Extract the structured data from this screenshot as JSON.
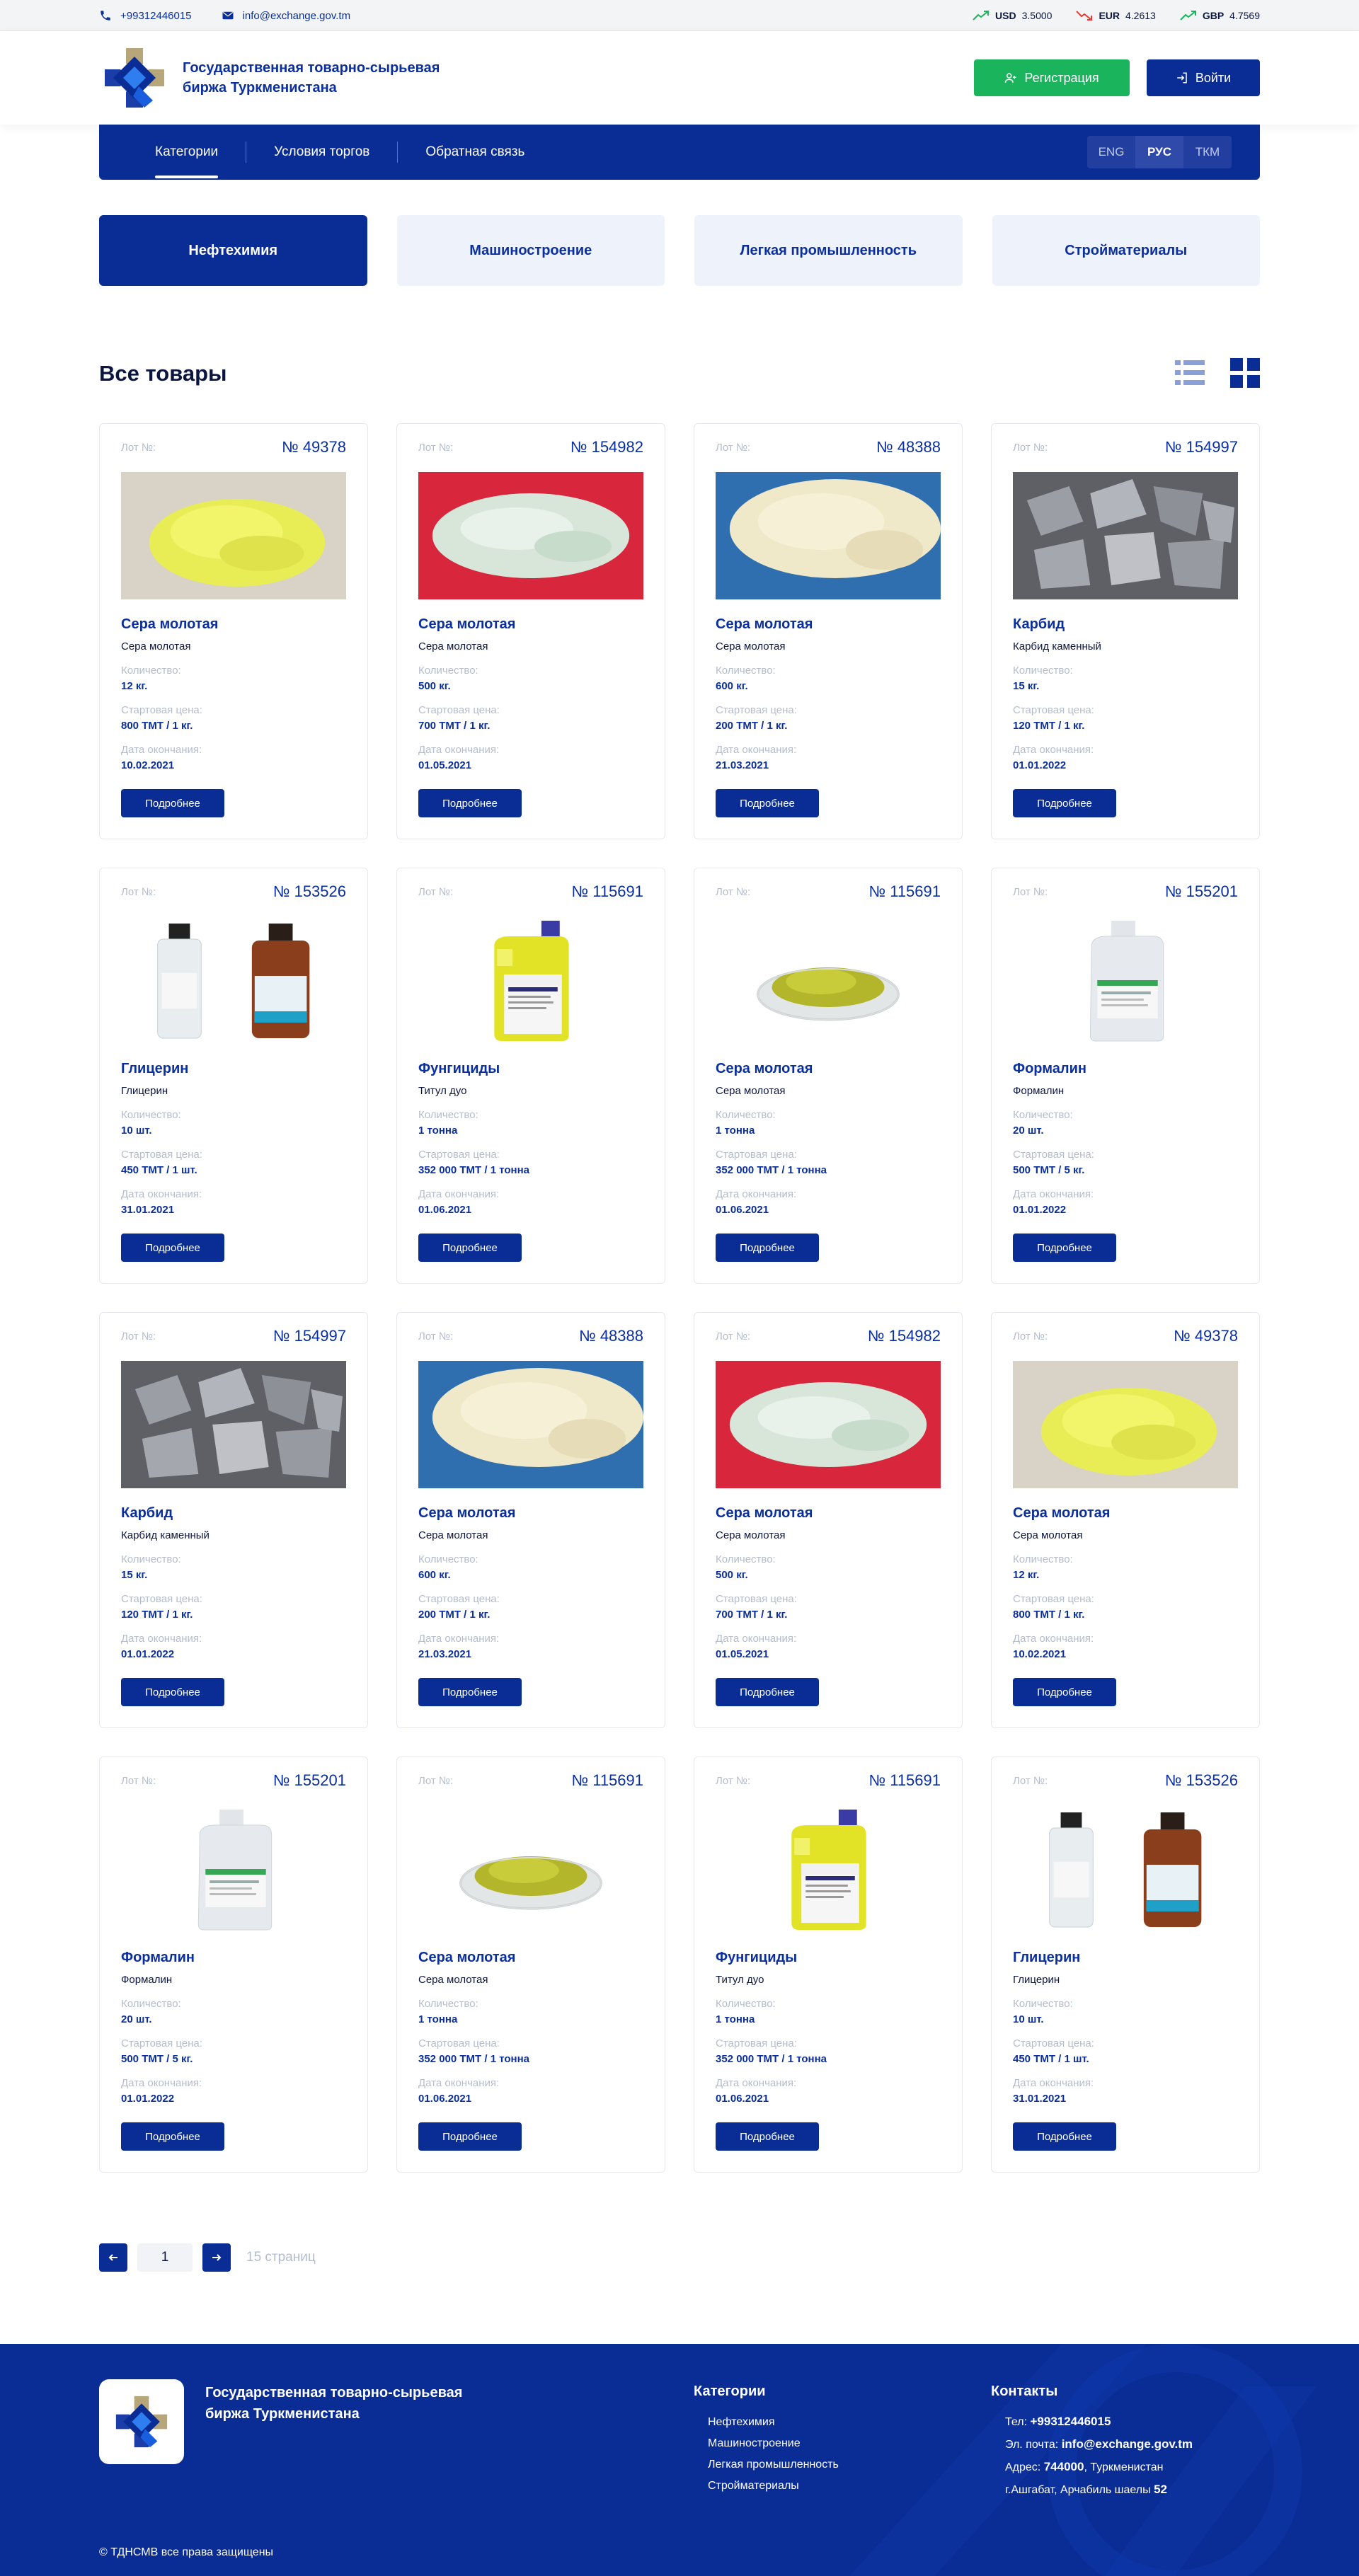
{
  "topbar": {
    "phone": "+99312446015",
    "email": "info@exchange.gov.tm",
    "rates": [
      {
        "code": "USD",
        "value": "3.5000",
        "trend": "up"
      },
      {
        "code": "EUR",
        "value": "4.2613",
        "trend": "down"
      },
      {
        "code": "GBP",
        "value": "4.7569",
        "trend": "up"
      }
    ]
  },
  "header": {
    "brand": "Государственная товарно-сырьевая биржа Туркменистана",
    "register_label": "Регистрация",
    "login_label": "Войти"
  },
  "nav": {
    "links": [
      "Категории",
      "Условия торгов",
      "Обратная связь"
    ],
    "active": 0,
    "langs": [
      "ENG",
      "РУС",
      "ТКМ"
    ],
    "active_lang": 1
  },
  "categories": [
    "Нефтехимия",
    "Машиностроение",
    "Легкая промышленность",
    "Стройматериалы"
  ],
  "section_title": "Все товары",
  "card_labels": {
    "lot": "Лот №:",
    "quantity": "Количество:",
    "price": "Стартовая цена:",
    "end": "Дата окончания:",
    "more": "Подробнее"
  },
  "products": [
    {
      "lot": "№ 49378",
      "image": "sulfur-yellow",
      "title": "Сера молотая",
      "subtitle": "Сера молотая",
      "qty": "12 кг.",
      "price": "800 ТМТ / 1 кг.",
      "end": "10.02.2021"
    },
    {
      "lot": "№ 154982",
      "image": "powder-red",
      "title": "Сера молотая",
      "subtitle": "Сера молотая",
      "qty": "500 кг.",
      "price": "700 ТМТ / 1 кг.",
      "end": "01.05.2021"
    },
    {
      "lot": "№ 48388",
      "image": "powder-blue",
      "title": "Сера молотая",
      "subtitle": "Сера молотая",
      "qty": "600 кг.",
      "price": "200 ТМТ / 1 кг.",
      "end": "21.03.2021"
    },
    {
      "lot": "№ 154997",
      "image": "carbide",
      "title": "Карбид",
      "subtitle": "Карбид каменный",
      "qty": "15 кг.",
      "price": "120 ТМТ / 1 кг.",
      "end": "01.01.2022"
    },
    {
      "lot": "№ 153526",
      "image": "glycerin",
      "title": "Глицерин",
      "subtitle": "Глицерин",
      "qty": "10 шт.",
      "price": "450 ТМТ / 1 шт.",
      "end": "31.01.2021"
    },
    {
      "lot": "№ 115691",
      "image": "fungicide",
      "title": "Фунгициды",
      "subtitle": "Титул дуо",
      "qty": "1 тонна",
      "price": "352 000 ТМТ / 1 тонна",
      "end": "01.06.2021"
    },
    {
      "lot": "№ 115691",
      "image": "dish",
      "title": "Сера молотая",
      "subtitle": "Сера молотая",
      "qty": "1 тонна",
      "price": "352 000 ТМТ / 1 тонна",
      "end": "01.06.2021"
    },
    {
      "lot": "№ 155201",
      "image": "formalin",
      "title": "Формалин",
      "subtitle": "Формалин",
      "qty": "20 шт.",
      "price": "500 ТМТ / 5 кг.",
      "end": "01.01.2022"
    },
    {
      "lot": "№ 154997",
      "image": "carbide",
      "title": "Карбид",
      "subtitle": "Карбид каменный",
      "qty": "15 кг.",
      "price": "120 ТМТ / 1 кг.",
      "end": "01.01.2022"
    },
    {
      "lot": "№ 48388",
      "image": "powder-blue",
      "title": "Сера молотая",
      "subtitle": "Сера молотая",
      "qty": "600 кг.",
      "price": "200 ТМТ / 1 кг.",
      "end": "21.03.2021"
    },
    {
      "lot": "№ 154982",
      "image": "powder-red",
      "title": "Сера молотая",
      "subtitle": "Сера молотая",
      "qty": "500 кг.",
      "price": "700 ТМТ / 1 кг.",
      "end": "01.05.2021"
    },
    {
      "lot": "№ 49378",
      "image": "sulfur-yellow",
      "title": "Сера молотая",
      "subtitle": "Сера молотая",
      "qty": "12 кг.",
      "price": "800 ТМТ / 1 кг.",
      "end": "10.02.2021"
    },
    {
      "lot": "№ 155201",
      "image": "formalin",
      "title": "Формалин",
      "subtitle": "Формалин",
      "qty": "20 шт.",
      "price": "500 ТМТ / 5 кг.",
      "end": "01.01.2022"
    },
    {
      "lot": "№ 115691",
      "image": "dish",
      "title": "Сера молотая",
      "subtitle": "Сера молотая",
      "qty": "1 тонна",
      "price": "352 000 ТМТ / 1 тонна",
      "end": "01.06.2021"
    },
    {
      "lot": "№ 115691",
      "image": "fungicide",
      "title": "Фунгициды",
      "subtitle": "Титул дуо",
      "qty": "1 тонна",
      "price": "352 000 ТМТ / 1 тонна",
      "end": "01.06.2021"
    },
    {
      "lot": "№ 153526",
      "image": "glycerin",
      "title": "Глицерин",
      "subtitle": "Глицерин",
      "qty": "10 шт.",
      "price": "450 ТМТ / 1 шт.",
      "end": "31.01.2021"
    }
  ],
  "pagination": {
    "current": "1",
    "total": "15 страниц"
  },
  "footer": {
    "brand": "Государственная товарно-сырьевая биржа Туркменистана",
    "categories_title": "Категории",
    "categories": [
      "Нефтехимия",
      "Машиностроение",
      "Легкая промышленность",
      "Стройматериалы"
    ],
    "contacts_title": "Контакты",
    "phone_label": "Тел:",
    "phone": "+99312446015",
    "email_label": "Эл. почта:",
    "email": "info@exchange.gov.tm",
    "address_label": "Адрес:",
    "address_line1_num": "744000",
    "address_line1_rest": ", Туркменистан",
    "address_line2": "г.Ашгабат, Арчабиль шаелы",
    "address_line2_num": "52",
    "copyright": "© ТДНСМВ все права защищены"
  },
  "colors": {
    "primary": "#0a2d95",
    "green": "#19b45c",
    "light": "#eef2fb"
  }
}
